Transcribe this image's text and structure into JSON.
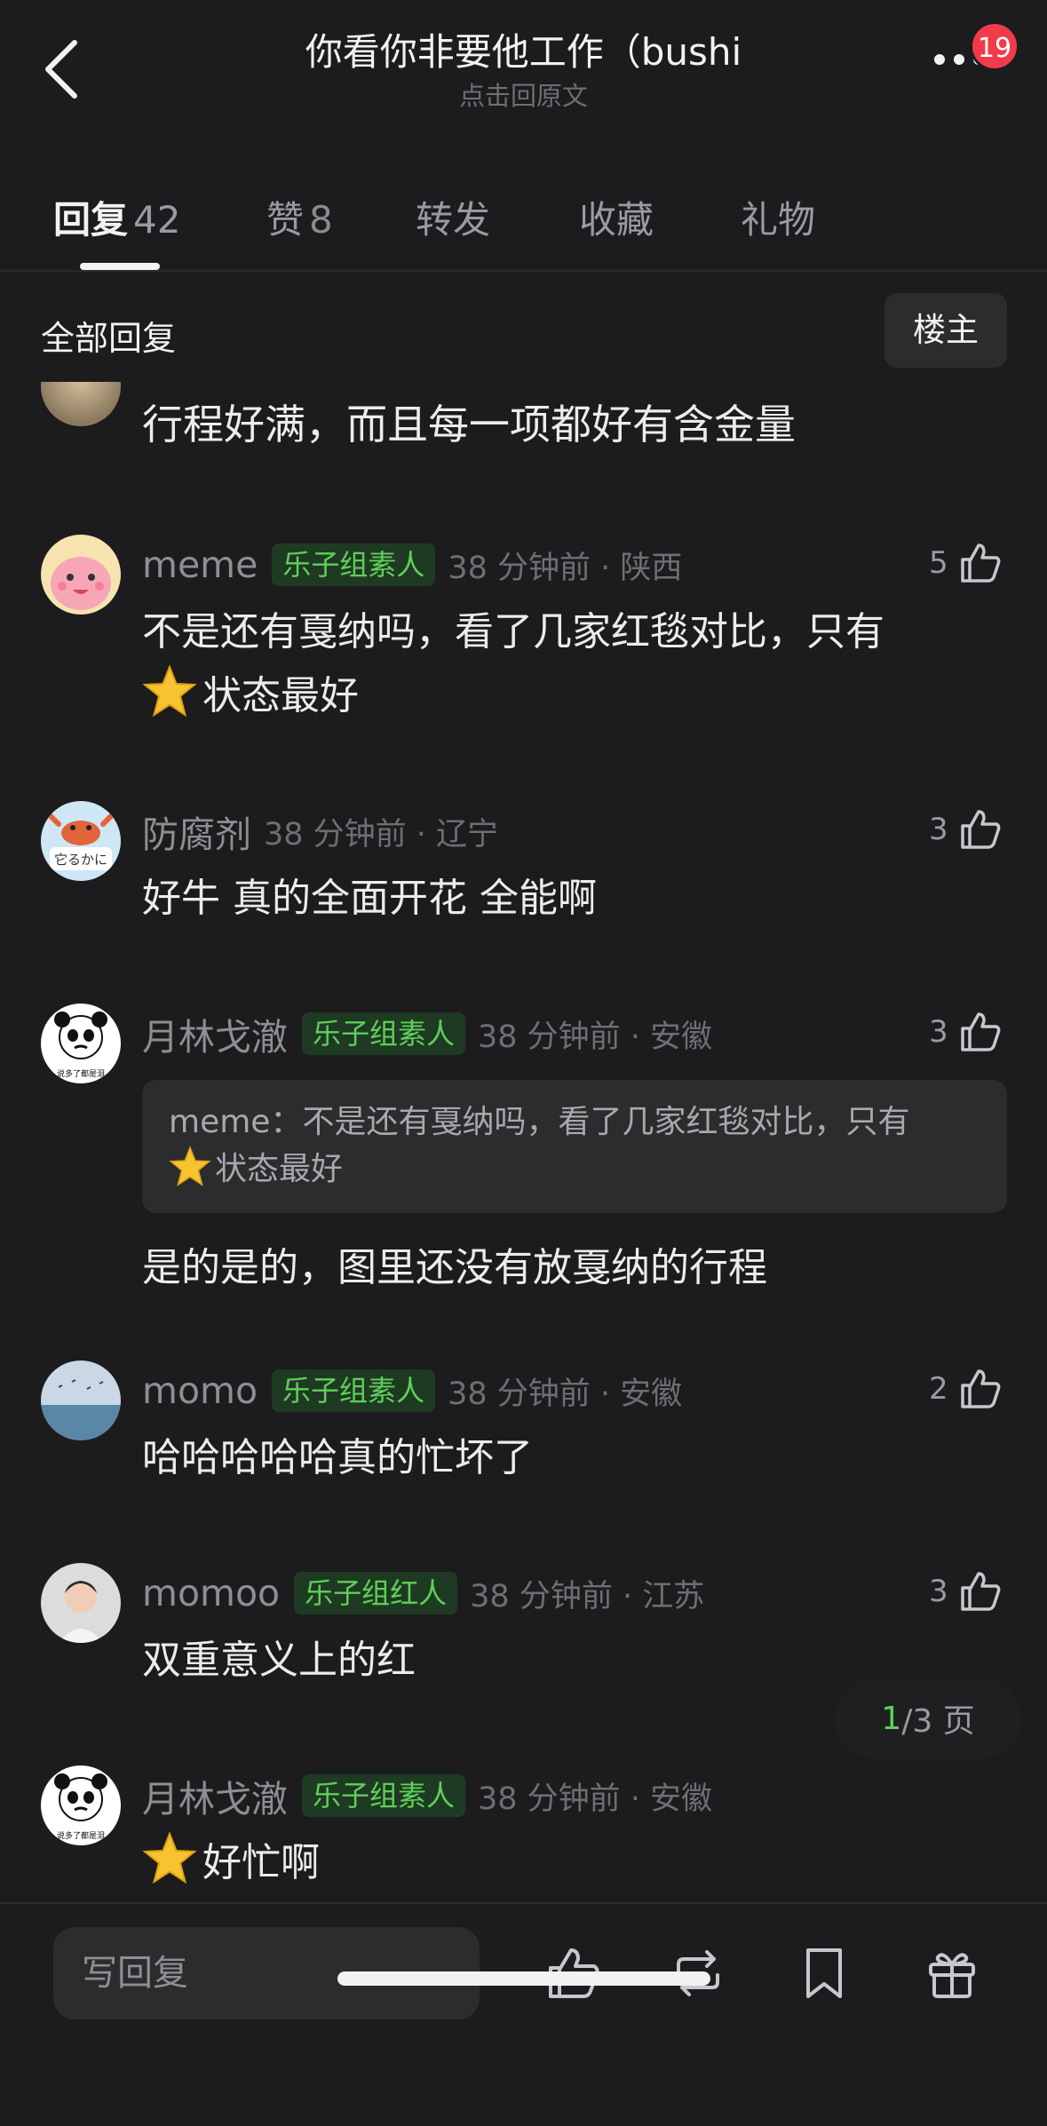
{
  "header": {
    "title": "你看你非要他工作（bushi",
    "subtitle": "点击回原文",
    "notification_count": "19",
    "back_icon": "chevron-left-icon",
    "more_icon": "more-dots-icon"
  },
  "tabs": [
    {
      "label": "回复",
      "count": "42",
      "active": true
    },
    {
      "label": "赞",
      "count": "8",
      "active": false
    },
    {
      "label": "转发",
      "count": "",
      "active": false
    },
    {
      "label": "收藏",
      "count": "",
      "active": false
    },
    {
      "label": "礼物",
      "count": "",
      "active": false
    }
  ],
  "filter": {
    "label": "全部回复",
    "op_button": "楼主"
  },
  "partial_comment": {
    "text": "行程好满，而且每一项都好有含金量"
  },
  "comments": [
    {
      "nick": "meme",
      "tag": "乐子组素人",
      "time": "38 分钟前 · 陕西",
      "likes": "5",
      "text_line1": "不是还有戛纳吗，看了几家红毯对比，只有",
      "text_line2": "状态最好"
    },
    {
      "nick": "防腐剂",
      "tag": "",
      "time": "38 分钟前 · 辽宁",
      "likes": "3",
      "text_line1": "好牛 真的全面开花 全能啊"
    },
    {
      "nick": "月林戈澈",
      "tag": "乐子组素人",
      "time": "38 分钟前 · 安徽",
      "likes": "3",
      "quote_author": "meme：",
      "quote_line1": "不是还有戛纳吗，看了几家红毯对比，只有",
      "quote_line2": "状态最好",
      "text_line1": "是的是的，图里还没有放戛纳的行程"
    },
    {
      "nick": "momo",
      "tag": "乐子组素人",
      "time": "38 分钟前 · 安徽",
      "likes": "2",
      "text_line1": "哈哈哈哈哈真的忙坏了"
    },
    {
      "nick": "momoo",
      "tag": "乐子组红人",
      "time": "38 分钟前 · 江苏",
      "likes": "3",
      "text_line1": "双重意义上的红"
    },
    {
      "nick": "月林戈澈",
      "tag": "乐子组素人",
      "time": "38 分钟前 · 安徽",
      "likes": "",
      "text_line1": "好忙啊"
    }
  ],
  "avatar_captions": {
    "crab": "它るかに",
    "panda": "说多了都是泪"
  },
  "pager": {
    "current": "1",
    "total": "/3 页"
  },
  "bottom_bar": {
    "reply_placeholder": "写回复",
    "icons": [
      "thumbs-up-icon",
      "repost-icon",
      "bookmark-icon",
      "gift-icon"
    ]
  },
  "colors": {
    "background": "#1c1c1e",
    "tag_green": "#5fcf5a",
    "badge_red": "#f23b4a"
  }
}
